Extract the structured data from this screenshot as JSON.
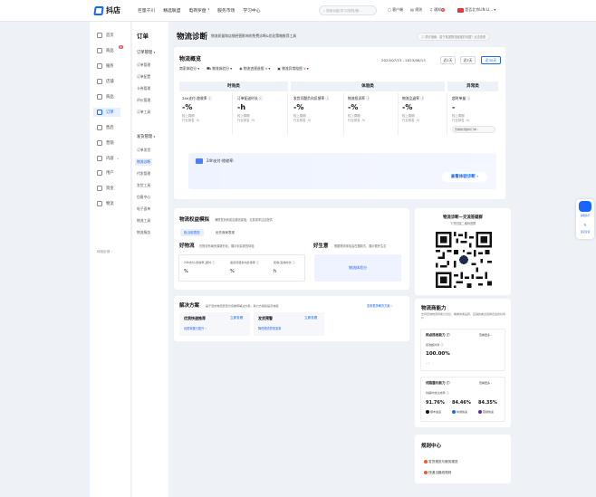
{
  "header": {
    "brand": "抖店",
    "nav": [
      "巨量千川",
      "精选联盟",
      "电商罗盘",
      "服务市场",
      "学习中心"
    ],
    "search_placeholder": "搜索功能/学习/规则/服...",
    "right": [
      "客户端",
      "规则",
      "通知",
      "是否北京LIN LI..."
    ],
    "notif_count": "5"
  },
  "sidebar": {
    "items": [
      "首页",
      "商品",
      "服务",
      "店铺",
      "商品",
      "订单",
      "售后",
      "营销",
      "内容",
      "用户",
      "资金",
      "物流"
    ],
    "new_badge": "新",
    "footer": "体验反馈 ›"
  },
  "subnav": {
    "title": "订单",
    "group1": "订单管理",
    "g1items": [
      "订单管理",
      "订单配置",
      "卡券管理",
      "评价管理",
      "订单工具"
    ],
    "group2": "发货管理",
    "g2items": [
      "订单发货",
      "物流诊断",
      "代发管理",
      "发货工具",
      "包裹中心",
      "电子面单",
      "物流工具",
      "物流服务"
    ]
  },
  "page": {
    "title": "物流诊断",
    "subtitle": "物流质量和店铺经营影响的免费诊断&优化策略推荐工具",
    "helper": "帮手指南：若于某提物流维度的问题？点击查看"
  },
  "overview": {
    "title": "物流概览",
    "filters": [
      "商家体验分",
      "物流体验分",
      "物流违规造假",
      "物流异常赔偿"
    ],
    "date_range": "2023/07/15 - 2023/08/13",
    "ranges": [
      "近1天",
      "近7天",
      "近30天"
    ],
    "tabs": [
      "时效类",
      "体验类",
      "异常类"
    ],
    "metrics": [
      {
        "t": "24h支付-揽收率 ⓘ",
        "v": "-%",
        "s1": "较上周期",
        "s2": "行业排名 -%"
      },
      {
        "t": "订单配送时长 ⓘ",
        "v": "-h",
        "s1": "较上周期",
        "s2": "行业排名 -%"
      },
      {
        "t": "发货问题负向反馈率 ⓘ",
        "v": "-%",
        "s1": "较上周期",
        "s2": "行业排名 -%"
      },
      {
        "t": "物流投诉率 ⓘ",
        "v": "-%",
        "s1": "较上周期",
        "s2": "行业排名 -%"
      },
      {
        "t": "物流品退率 ⓘ",
        "v": "-%",
        "s1": "较上周期",
        "s2": "行业排名 -%"
      },
      {
        "t": "超时单量 ⓘ",
        "v": "-",
        "s1": "较上周期",
        "s2": "行业排名 -%",
        "link": "查看物流超时订单 ›"
      }
    ],
    "banner_text": "24h支付-揽收率:",
    "banner_btn": "查看体验诊断 ›"
  },
  "rights": {
    "title": "物流权益模拟",
    "desc": "满预发到商或店铺流量值，交易需求注目提供",
    "tabs": [
      "极当前表现",
      "优先商家表现"
    ],
    "good_title": "好物流",
    "good_desc": "在物流布局资源新形化，展示到买家的体验",
    "good_cols": [
      {
        "l": "24h支付-揽收率_额外 ⓘ",
        "v": "%"
      },
      {
        "l": "发货问题负向反馈率 ⓘ",
        "v": "%"
      },
      {
        "l": "揽收-签收时长 ⓘ",
        "v": "h"
      }
    ],
    "star_title": "好生意",
    "star_desc": "根据物流体验会在据制式，展示额外生意",
    "star_item": "物流体验分"
  },
  "solutions": {
    "title": "解决方案",
    "desc": "基于您的物流表现为您推荐解决方案，助力方案和提高效能",
    "more": "查看更多解决方案 ›",
    "cards": [
      {
        "title": "优质快递推荐",
        "cta": "立即查看",
        "sub": "优质单推行提升 ›"
      },
      {
        "title": "发货预警",
        "cta": "立即查看",
        "sub": "降低物流异常发单"
      }
    ]
  },
  "qrpanel": {
    "title": "物流诊断—交流答疑群",
    "sub": "飞书扫描二维码进群"
  },
  "capacity": {
    "title": "物流商能力",
    "desc": "支持查询物流商能力对比，看看效果品牌，店铺的看法选择合适的好商户",
    "block1": {
      "title": "网点揽收能力 ⓘ",
      "more": "查看更多 ›",
      "label": "揽收超时率 ⓘ",
      "value": "100.00%",
      "line": "-- /"
    },
    "block2": {
      "title": "线路履约能力 ⓘ",
      "more": "查看更多 ›",
      "label": "线路时效达成率 ⓘ",
      "values": [
        "91.76%",
        "84.46%",
        "84.35%"
      ],
      "carriers": [
        "顺丰速运",
        "中通快递",
        "圆通快递"
      ]
    }
  },
  "rules": {
    "title": "规则中心",
    "items": [
      "发货规范与服务规范",
      "快递当路线规则"
    ]
  },
  "float": {
    "label1": "客服助手",
    "label2": "意见反馈"
  }
}
